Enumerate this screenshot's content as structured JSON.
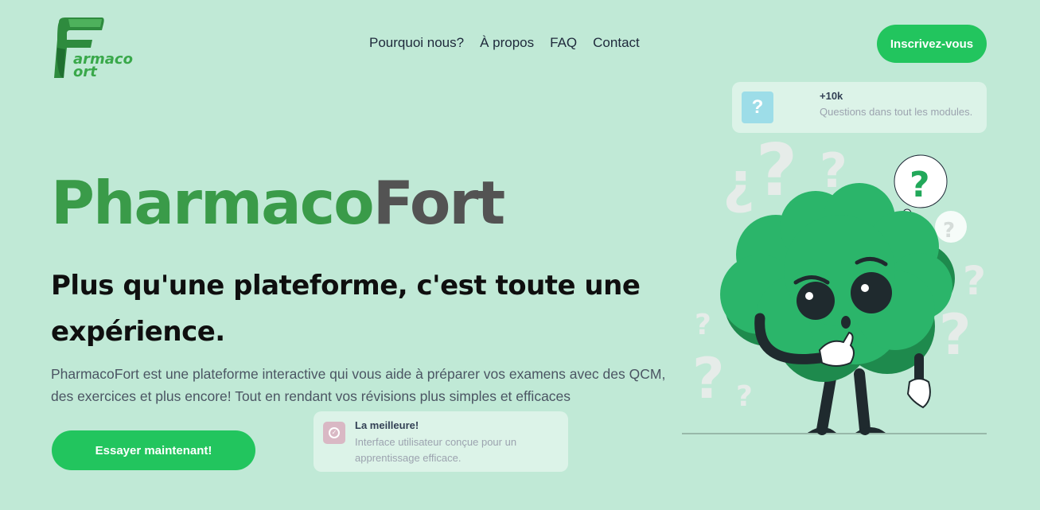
{
  "header": {
    "logo_line1": "armaco",
    "logo_line2": "ort",
    "nav": [
      "Pourquoi nous?",
      "À propos",
      "FAQ",
      "Contact"
    ],
    "signup_label": "Inscrivez-vous"
  },
  "hero": {
    "title_part1": "Pharmaco",
    "title_part2": "Fort",
    "subtitle": "Plus qu'une plateforme, c'est toute une expérience.",
    "description": "PharmacoFort est une plateforme interactive qui vous aide à préparer vos examens avec des QCM, des exercices et plus encore! Tout en rendant vos révisions plus simples et efficaces",
    "cta_label": "Essayer maintenant!"
  },
  "stats_card": {
    "icon": "question-icon",
    "icon_glyph": "?",
    "title": "+10k",
    "text": "Questions dans tout les modules."
  },
  "best_card": {
    "icon": "check-circle-icon",
    "title": "La meilleure!",
    "text": "Interface utilisateur conçue pour un apprentissage efficace."
  },
  "colors": {
    "background": "#c0e9d6",
    "accent": "#22c55e",
    "brand_green": "#3a9b49",
    "brand_gray": "#535353",
    "mascot": "#2bb56a"
  }
}
